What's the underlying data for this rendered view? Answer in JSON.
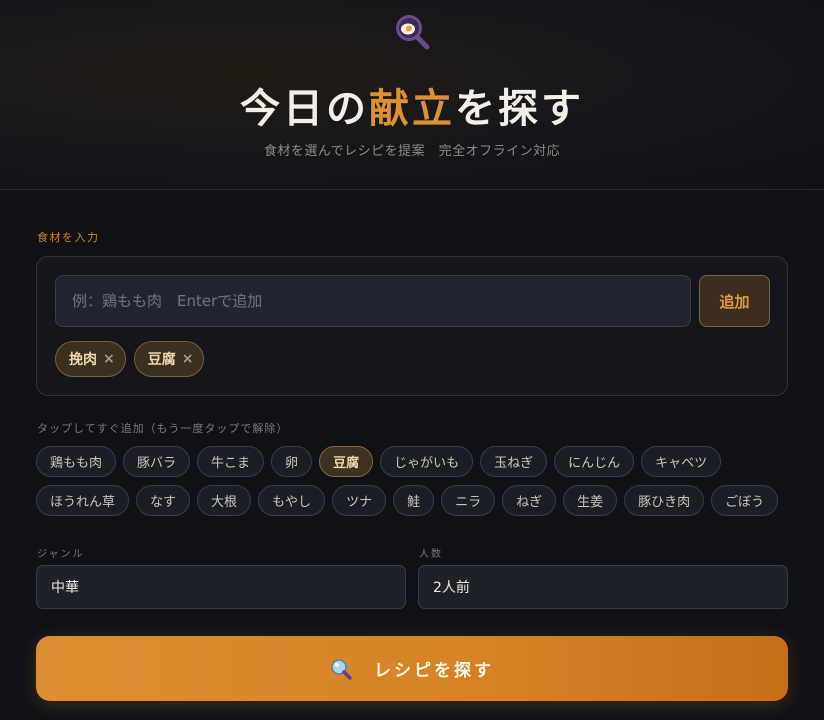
{
  "header": {
    "logo_icon": "magnifier-with-egg-icon",
    "title_pre": "今日の",
    "title_accent": "献立",
    "title_post": "を探す",
    "subtitle": "食材を選んでレシピを提案　完全オフライン対応"
  },
  "ingredients": {
    "section_label": "食材を入力",
    "input_placeholder": "例：鶏もも肉　Enterで追加",
    "input_value": "",
    "add_label": "追加",
    "selected": [
      {
        "label": "挽肉",
        "remove": "×"
      },
      {
        "label": "豆腐",
        "remove": "×"
      }
    ]
  },
  "quick_add": {
    "label": "タップしてすぐ追加（もう一度タップで解除）",
    "chips": [
      {
        "label": "鶏もも肉",
        "active": false
      },
      {
        "label": "豚バラ",
        "active": false
      },
      {
        "label": "牛こま",
        "active": false
      },
      {
        "label": "卵",
        "active": false
      },
      {
        "label": "豆腐",
        "active": true
      },
      {
        "label": "じゃがいも",
        "active": false
      },
      {
        "label": "玉ねぎ",
        "active": false
      },
      {
        "label": "にんじん",
        "active": false
      },
      {
        "label": "キャベツ",
        "active": false
      },
      {
        "label": "ほうれん草",
        "active": false
      },
      {
        "label": "なす",
        "active": false
      },
      {
        "label": "大根",
        "active": false
      },
      {
        "label": "もやし",
        "active": false
      },
      {
        "label": "ツナ",
        "active": false
      },
      {
        "label": "鮭",
        "active": false
      },
      {
        "label": "ニラ",
        "active": false
      },
      {
        "label": "ねぎ",
        "active": false
      },
      {
        "label": "生姜",
        "active": false
      },
      {
        "label": "豚ひき肉",
        "active": false
      },
      {
        "label": "ごぼう",
        "active": false
      }
    ]
  },
  "genre": {
    "label": "ジャンル",
    "value": "中華"
  },
  "people": {
    "label": "人数",
    "value": "2人前"
  },
  "search": {
    "label": "レシピを探す",
    "icon": "magnifier-icon"
  },
  "colors": {
    "accent": "#dd9135",
    "background": "#0f1117"
  }
}
